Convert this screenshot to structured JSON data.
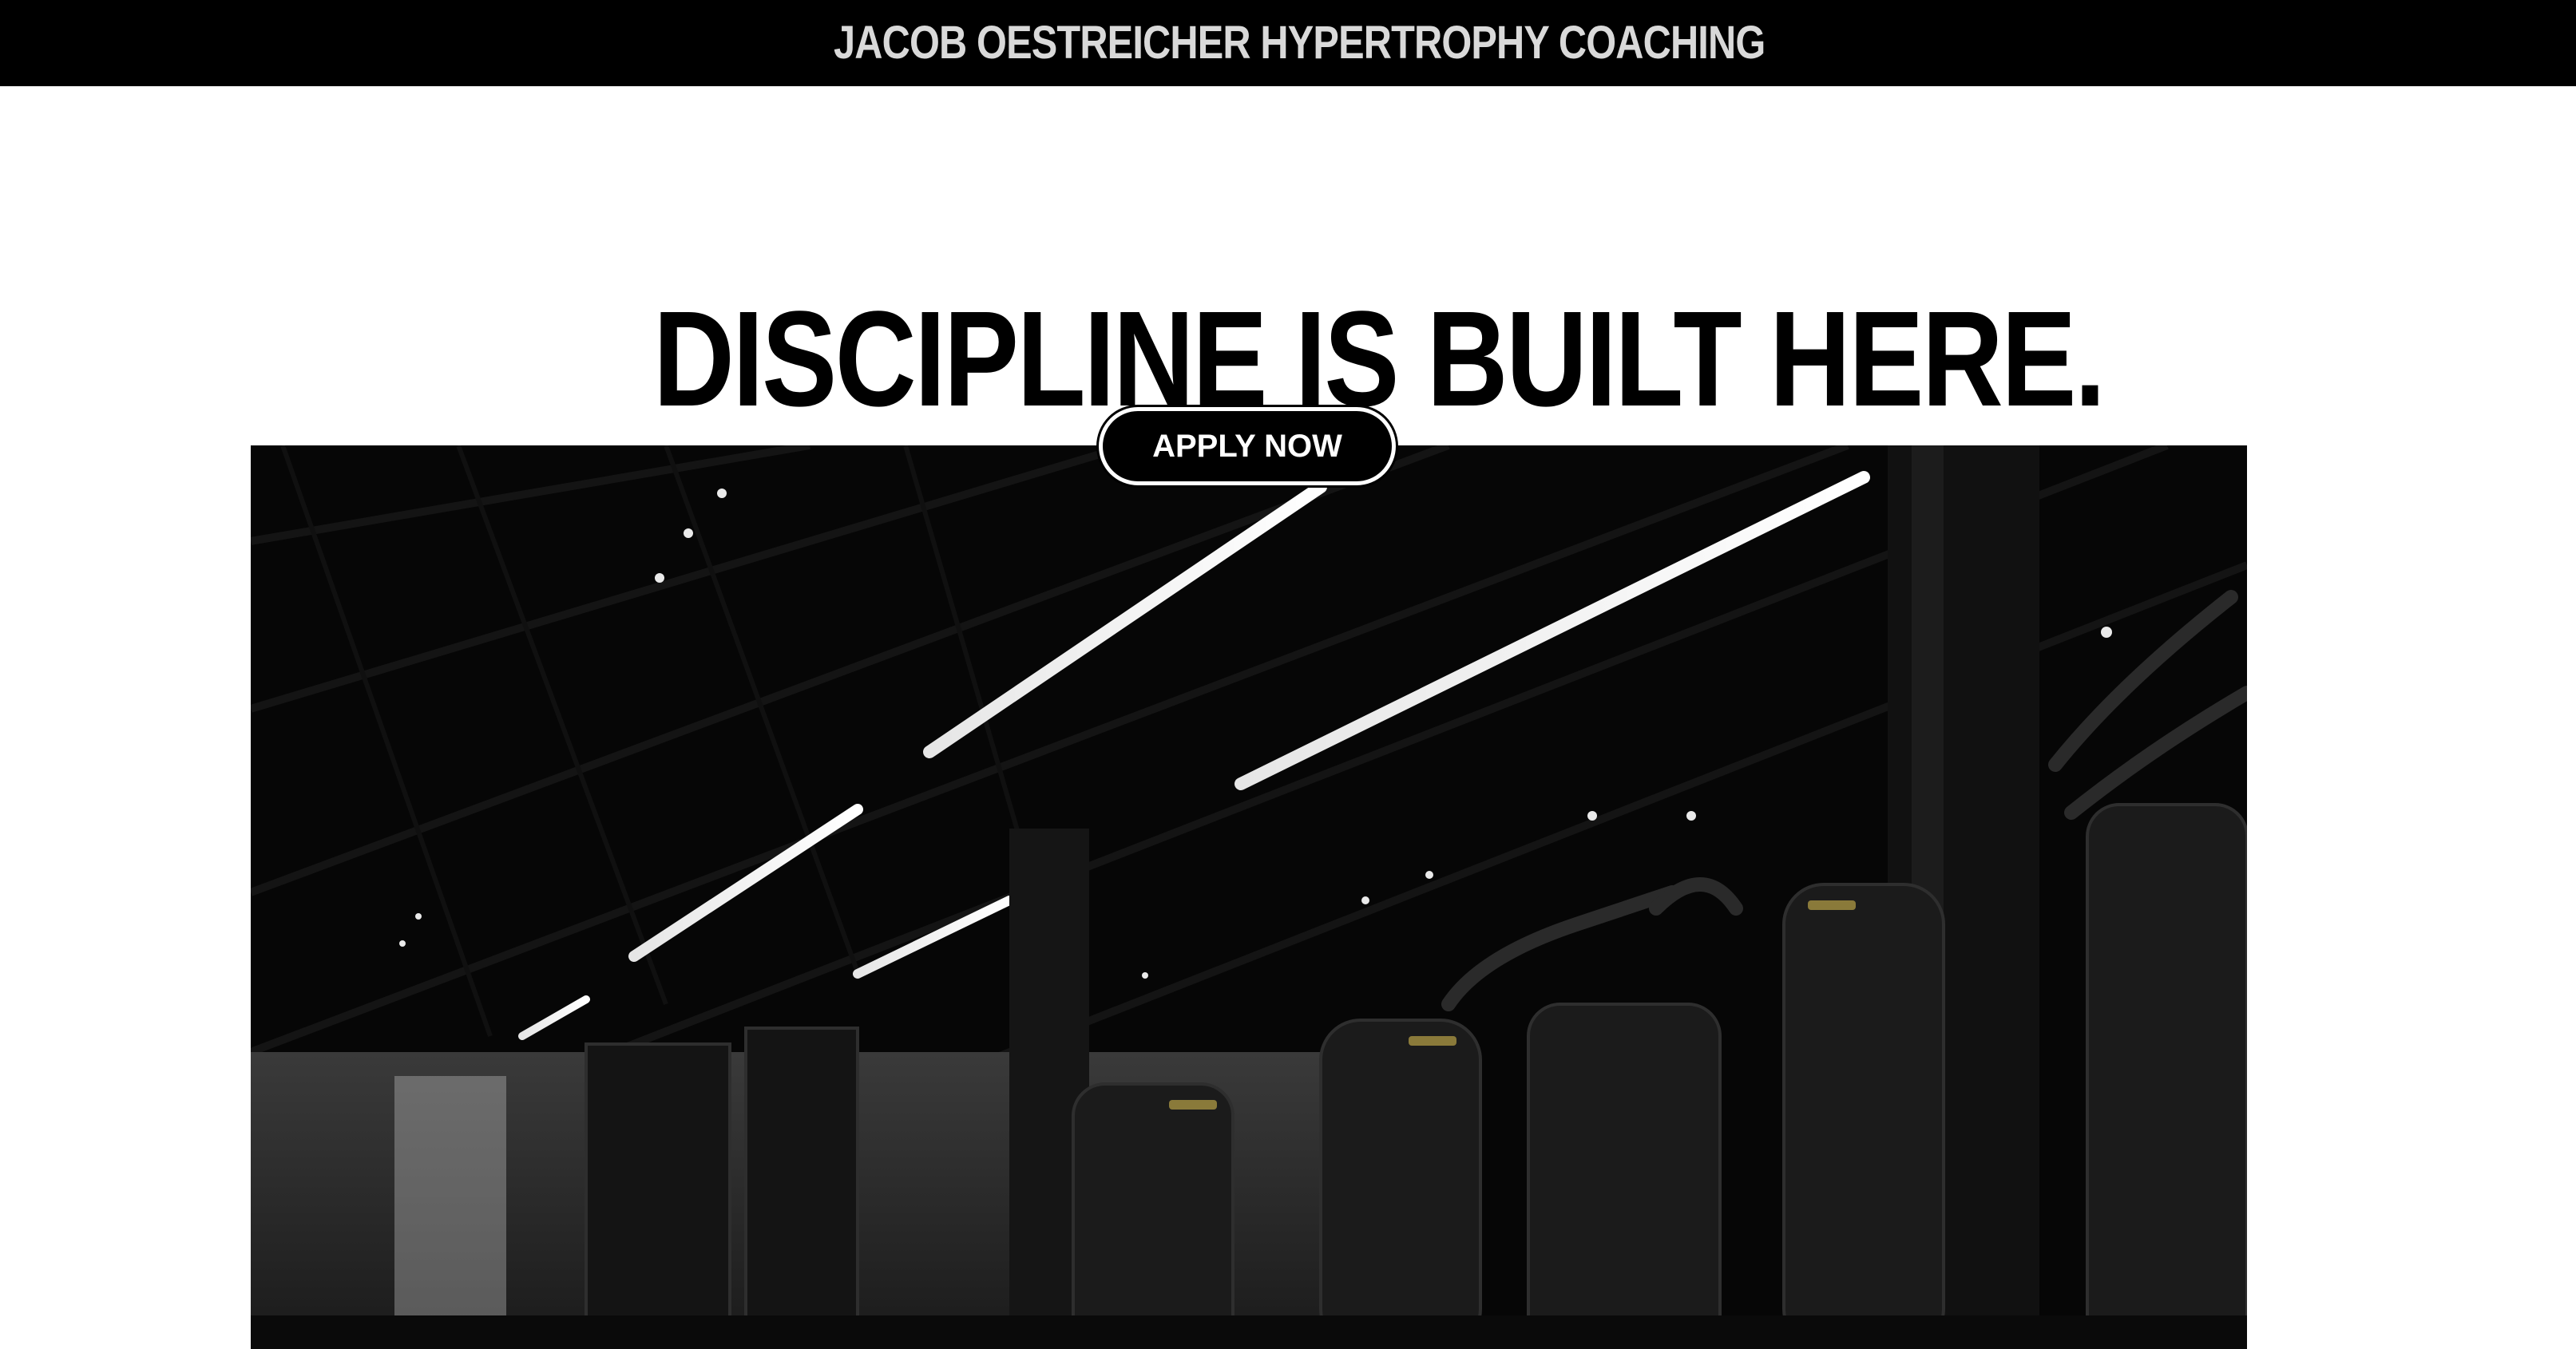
{
  "header": {
    "brand": "JACOB OESTREICHER HYPERTROPHY COACHING"
  },
  "hero": {
    "headline": "DISCIPLINE IS BUILT HERE.",
    "cta_label": "APPLY NOW",
    "image_description_icon": "gym-photo-image"
  },
  "colors": {
    "topbar_bg": "#000000",
    "brand_text": "#d9d9d9",
    "page_bg": "#ffffff",
    "headline": "#000000",
    "button_bg": "#000000",
    "button_text": "#ffffff"
  }
}
